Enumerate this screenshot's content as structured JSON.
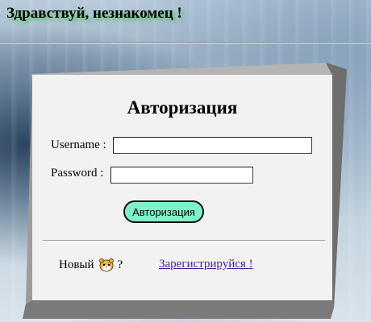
{
  "header": {
    "greeting": "Здравствуй, незнакомец !"
  },
  "login_panel": {
    "title": "Авторизация",
    "username_label": "Username :",
    "username_value": "",
    "password_label": "Password :",
    "password_value": "",
    "submit_label": "Авторизация"
  },
  "footer": {
    "new_prefix": "Новый",
    "new_icon": "hamster-icon",
    "new_suffix": "?",
    "register_link": "Зарегистрируйся !"
  },
  "colors": {
    "greeting_glow": "#28c83c",
    "button_fill": "#7ef2c8",
    "link": "#4b1f9e",
    "panel_bg": "#f2f2f2"
  }
}
